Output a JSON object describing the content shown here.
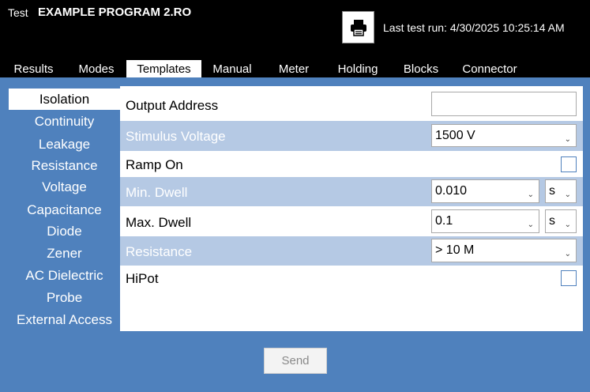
{
  "header": {
    "test_label": "Test",
    "program_name": "EXAMPLE PROGRAM 2.RO",
    "last_run": "Last test run: 4/30/2025 10:25:14 AM"
  },
  "tabs": [
    "Results",
    "Modes",
    "Templates",
    "Manual",
    "Meter",
    "Holding",
    "Blocks",
    "Connector"
  ],
  "active_tab": "Templates",
  "sidebar": {
    "items": [
      "Isolation",
      "Continuity",
      "Leakage",
      "Resistance",
      "Voltage",
      "Capacitance",
      "Diode",
      "Zener",
      "AC Dielectric",
      "Probe",
      "External Access"
    ],
    "active": "Isolation"
  },
  "form": {
    "output_address": {
      "label": "Output Address",
      "value": ""
    },
    "stimulus_voltage": {
      "label": "Stimulus Voltage",
      "value": "1500 V"
    },
    "ramp_on": {
      "label": "Ramp On",
      "checked": false
    },
    "min_dwell": {
      "label": "Min. Dwell",
      "value": "0.010",
      "unit": "s"
    },
    "max_dwell": {
      "label": "Max. Dwell",
      "value": "0.1",
      "unit": "s"
    },
    "resistance": {
      "label": "Resistance",
      "value": "> 10 M"
    },
    "hipot": {
      "label": "HiPot",
      "checked": false
    }
  },
  "send_label": "Send",
  "icons": {
    "print": "printer-icon",
    "dropdown": "chevron-down-icon"
  },
  "colors": {
    "panel_bg": "#4f81bd",
    "alt_row": "#b5c9e4",
    "header_bg": "#000000"
  }
}
